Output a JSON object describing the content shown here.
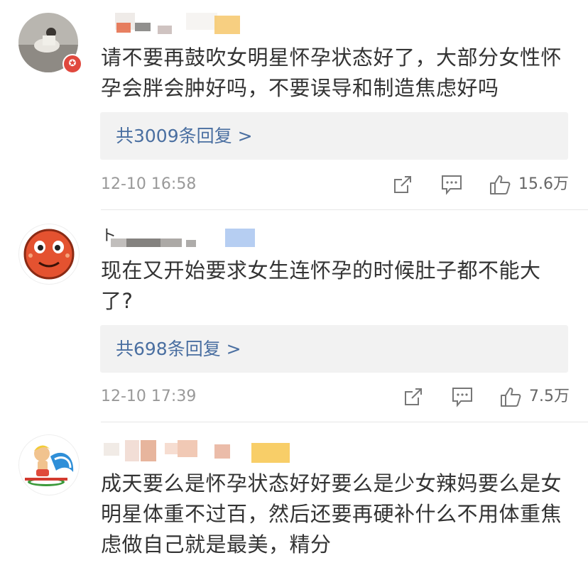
{
  "comments": [
    {
      "text": "请不要再鼓吹女明星怀孕状态好了，大部分女性怀孕会胖会肿好吗，不要误导和制造焦虑好吗",
      "reply_label": "共3009条回复 >",
      "time": "12-10 16:58",
      "likes": "15.6万",
      "user_prefix": ""
    },
    {
      "text": "现在又开始要求女生连怀孕的时候肚子都不能大了?",
      "reply_label": "共698条回复 >",
      "time": "12-10 17:39",
      "likes": "7.5万",
      "user_prefix": "ト"
    },
    {
      "text": "成天要么是怀孕状态好好要么是少女辣妈要么是女明星体重不过百，然后还要再硬补什么不用体重焦虑做自己就是最美，精分",
      "user_prefix": ""
    }
  ],
  "icons": [
    "share-icon",
    "comment-icon",
    "like-icon"
  ],
  "colors": {
    "reply_link": "#4a6fa1",
    "badge": "#e0483e",
    "reply_bg": "#f2f2f2"
  }
}
